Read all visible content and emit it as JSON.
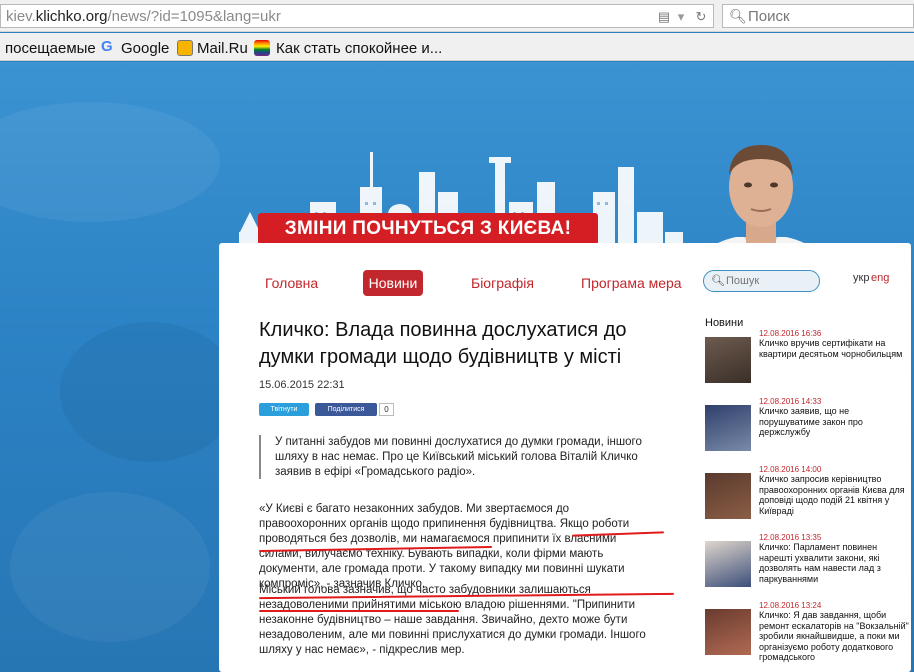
{
  "browser": {
    "url_domain": "klichko.org",
    "url_prefix": "kiev.",
    "url_path": "/news/?id=1095&lang=ukr",
    "search_placeholder": "Поиск",
    "bookmarks": [
      {
        "label": "посещаемые",
        "icon": "none"
      },
      {
        "label": "Google",
        "icon": "google-icon"
      },
      {
        "label": "Mail.Ru",
        "icon": "mailru-icon"
      },
      {
        "label": "Как стать спокойнее и...",
        "icon": "rainbow-icon"
      }
    ]
  },
  "site": {
    "banner": "ЗМІНИ ПОЧНУТЬСЯ З КИЄВА!",
    "nav": [
      {
        "label": "Головна",
        "active": false
      },
      {
        "label": "Новини",
        "active": true
      },
      {
        "label": "Біографія",
        "active": false
      },
      {
        "label": "Програма мера",
        "active": false
      }
    ],
    "search_placeholder": "Пошук",
    "lang_ukr": "укр",
    "lang_eng": "eng",
    "accent_color": "#c1272d"
  },
  "article": {
    "title": "Кличко: Влада повинна дослухатися до думки громади щодо будівництв у місті",
    "date": "15.06.2015 22:31",
    "share_twitter": "Твітнути",
    "share_facebook": "Поділитися",
    "share_count": "0",
    "lead": "У питанні забудов ми повинні дослухатися до думки громади, іншого шляху в нас немає. Про це Київський міський голова Віталій Кличко заявив в ефірі «Громадського радіо».",
    "p1_start": "«У Києві є багато незаконних забудов. Ми звертаємося до правоохоронних органів щодо припинення будівництва. Якщо роботи проводяться без дозволів, ми намагаємося припинити їх власними силами, вилучаємо техніку. ",
    "p1_highlight": "Бувають випадки, коли фірми мають документи, але громада проти",
    "p1_end": ". У такому випадку ми повинні шукати компроміс», - зазначив Кличко.",
    "p2_highlight": "Міський голова зазначив, що часто забудовники залишаються незадоволеними прийнятими міською владою рішеннями.",
    "p2_end": " \"Припинити незаконне будівництво – наше завдання. Звичайно, дехто може бути незадоволеним, але ми повинні прислухатися до думки громади. Іншого шляху у нас немає», - підкреслив мер."
  },
  "sidebar": {
    "heading": "Новини",
    "items": [
      {
        "time": "12.08.2016 16:36",
        "text": "Кличко вручив сертифікати на квартири десятьом чорнобильцям"
      },
      {
        "time": "12.08.2016 14:33",
        "text": "Кличко заявив, що не порушуватиме закон про держслужбу"
      },
      {
        "time": "12.08.2016 14:00",
        "text": "Кличко запросив керівництво правоохоронних органів Києва для доповіді щодо подій 21 квітня у Київраді"
      },
      {
        "time": "12.08.2016 13:35",
        "text": "Кличко: Парламент повинен нарешті ухвалити закони, які дозволять нам навести лад з паркуваннями"
      },
      {
        "time": "12.08.2016 13:24",
        "text": "Кличко: Я дав завдання, щоби ремонт ескалаторів на \"Вокзальній\" зробили якнайшвидше, а поки ми організуємо роботу додаткового громадського"
      }
    ]
  }
}
